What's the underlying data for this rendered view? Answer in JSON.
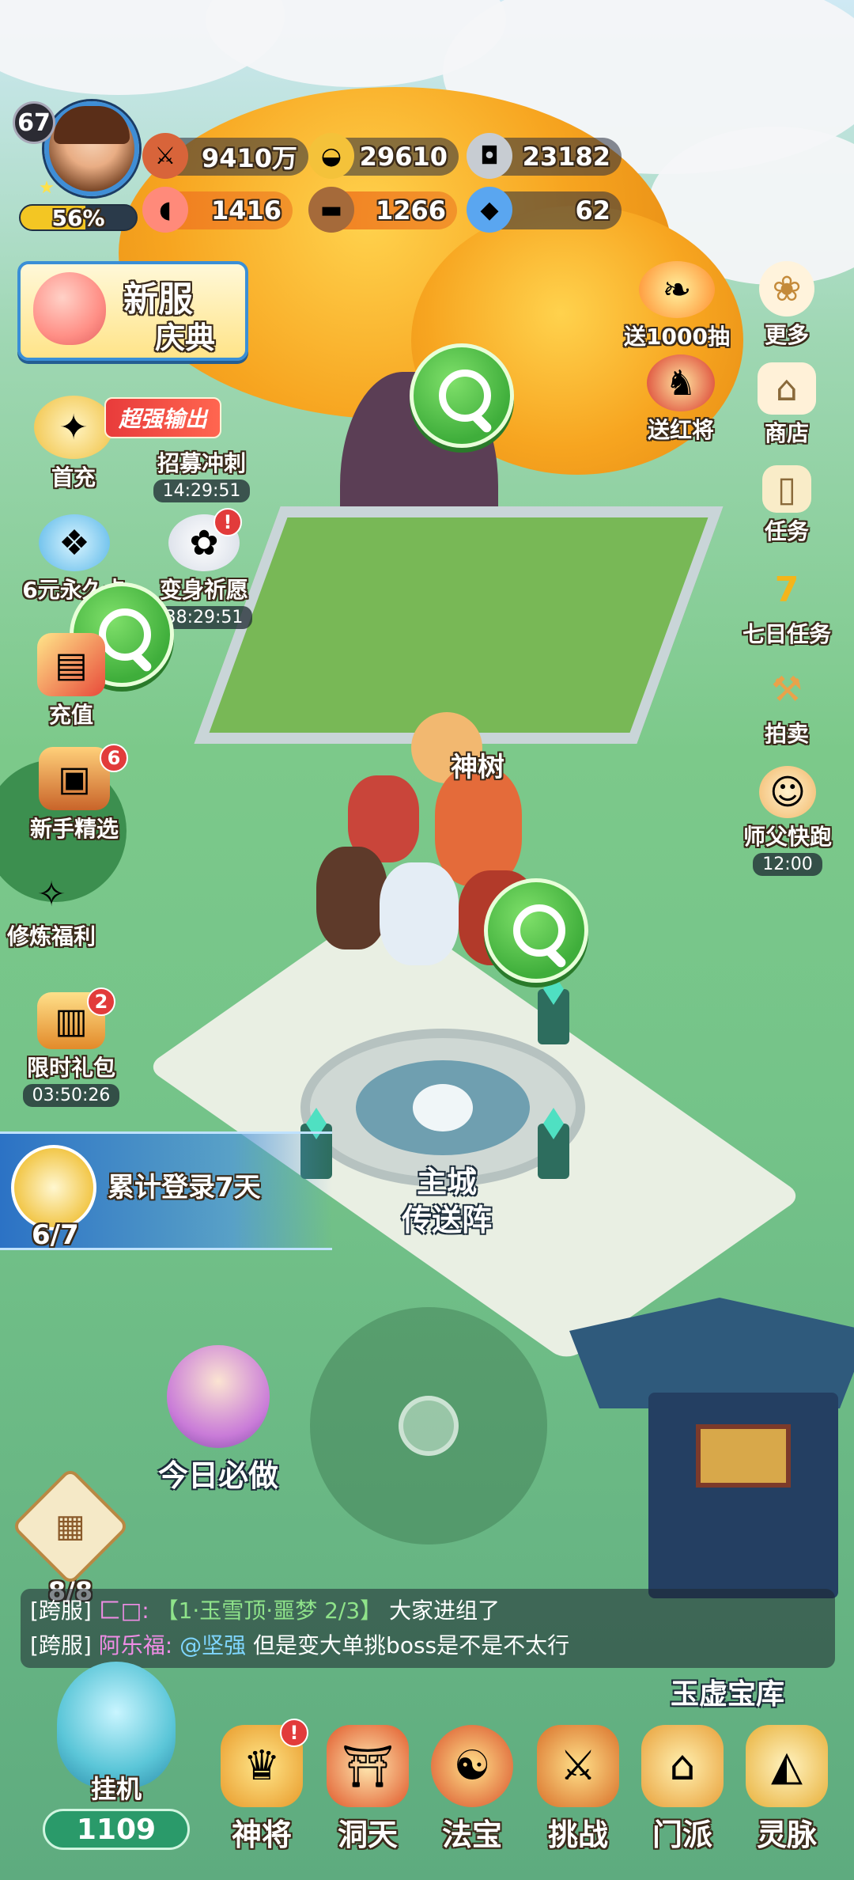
{
  "player": {
    "level": "67",
    "exp_percent_label": "56%",
    "exp_fraction": 0.56
  },
  "resources": {
    "combat_power": "9410万",
    "gold_ingot": "29610",
    "silver_coin": "23182",
    "meat": "1416",
    "wood": "1266",
    "crystal": "62"
  },
  "event_banner": {
    "line1": "新服",
    "line2": "庆典"
  },
  "left_menu": {
    "first_charge": "首充",
    "promo_chip": "超强输出",
    "recruit_sprint": "招募冲刺",
    "recruit_timer": "14:29:51",
    "monthly_card": "6元永久卡",
    "transform_wish": "变身祈愿",
    "transform_timer": "38:29:51",
    "transform_badge": "!",
    "recharge": "充值",
    "newbie_select": "新手精选",
    "newbie_badge": "6",
    "cultivation_welfare": "修炼福利",
    "limited_pack": "限时礼包",
    "limited_badge": "2",
    "limited_timer": "03:50:26"
  },
  "right_menu": {
    "draw_1000": "送1000抽",
    "more": "更多",
    "send_general": "送红将",
    "shop": "商店",
    "task": "任务",
    "seven_day_task": "七日任务",
    "auction": "拍卖",
    "master_run": "师父快跑",
    "master_run_timer": "12:00"
  },
  "map_labels": {
    "sacred_tree": "神树",
    "portal_line1": "主城",
    "portal_line2": "传送阵",
    "vault": "玉虚宝库"
  },
  "login_reward": {
    "title": "累计登录7天",
    "progress": "6/7"
  },
  "daily_must_do": "今日必做",
  "grid_button": {
    "count": "8/8"
  },
  "chat": [
    {
      "tag": "[跨服]",
      "name": "匚□",
      "sep": ":",
      "team": "【1·玉雪顶·噩梦 2/3】",
      "text": "大家进组了"
    },
    {
      "tag": "[跨服]",
      "name": "阿乐福",
      "sep": ":",
      "at": "@坚强",
      "text": "但是变大单挑boss是不是不太行"
    }
  ],
  "idle": {
    "label": "挂机",
    "count": "1109"
  },
  "bottom_nav": {
    "general": "神将",
    "general_badge": "!",
    "cave": "洞天",
    "treasure": "法宝",
    "challenge": "挑战",
    "sect": "门派",
    "spirit_vein": "灵脉"
  },
  "colors": {
    "accent_blue": "#3a8fd6",
    "badge_red": "#e23b3b",
    "exp_yellow": "#f3c623",
    "idle_green": "#2a9a6a"
  }
}
